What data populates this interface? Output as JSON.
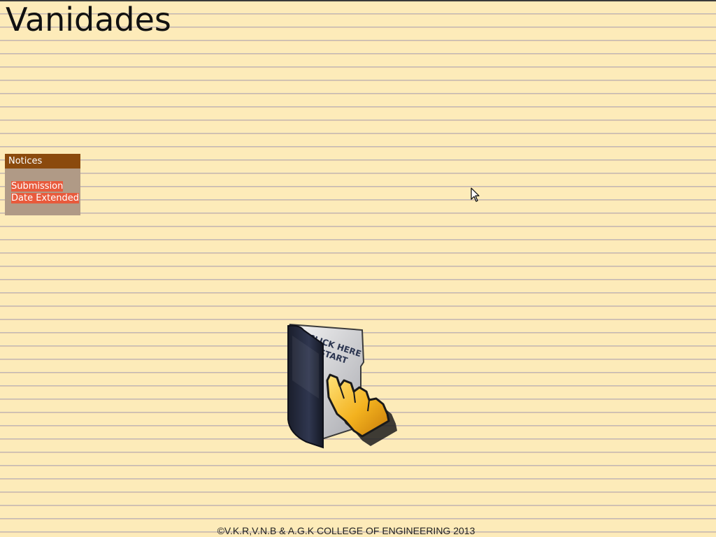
{
  "header": {
    "title": "Vanidades"
  },
  "notices": {
    "heading": "Notices",
    "items": [
      {
        "line1": "Submission",
        "line2": "Date Extended"
      }
    ]
  },
  "start": {
    "banner_line1": "CLICK HERE",
    "banner_line2": "TO START",
    "icon": "folder-hand-pointer-icon"
  },
  "footer": {
    "copyright": "©V.K.R,V.N.B & A.G.K COLLEGE OF ENGINEERING 2013"
  },
  "colors": {
    "page_background": "#fdebb9",
    "notice_header": "#8b4a0d",
    "notice_panel": "#b09a86",
    "notice_highlight": "#e85a3c"
  }
}
